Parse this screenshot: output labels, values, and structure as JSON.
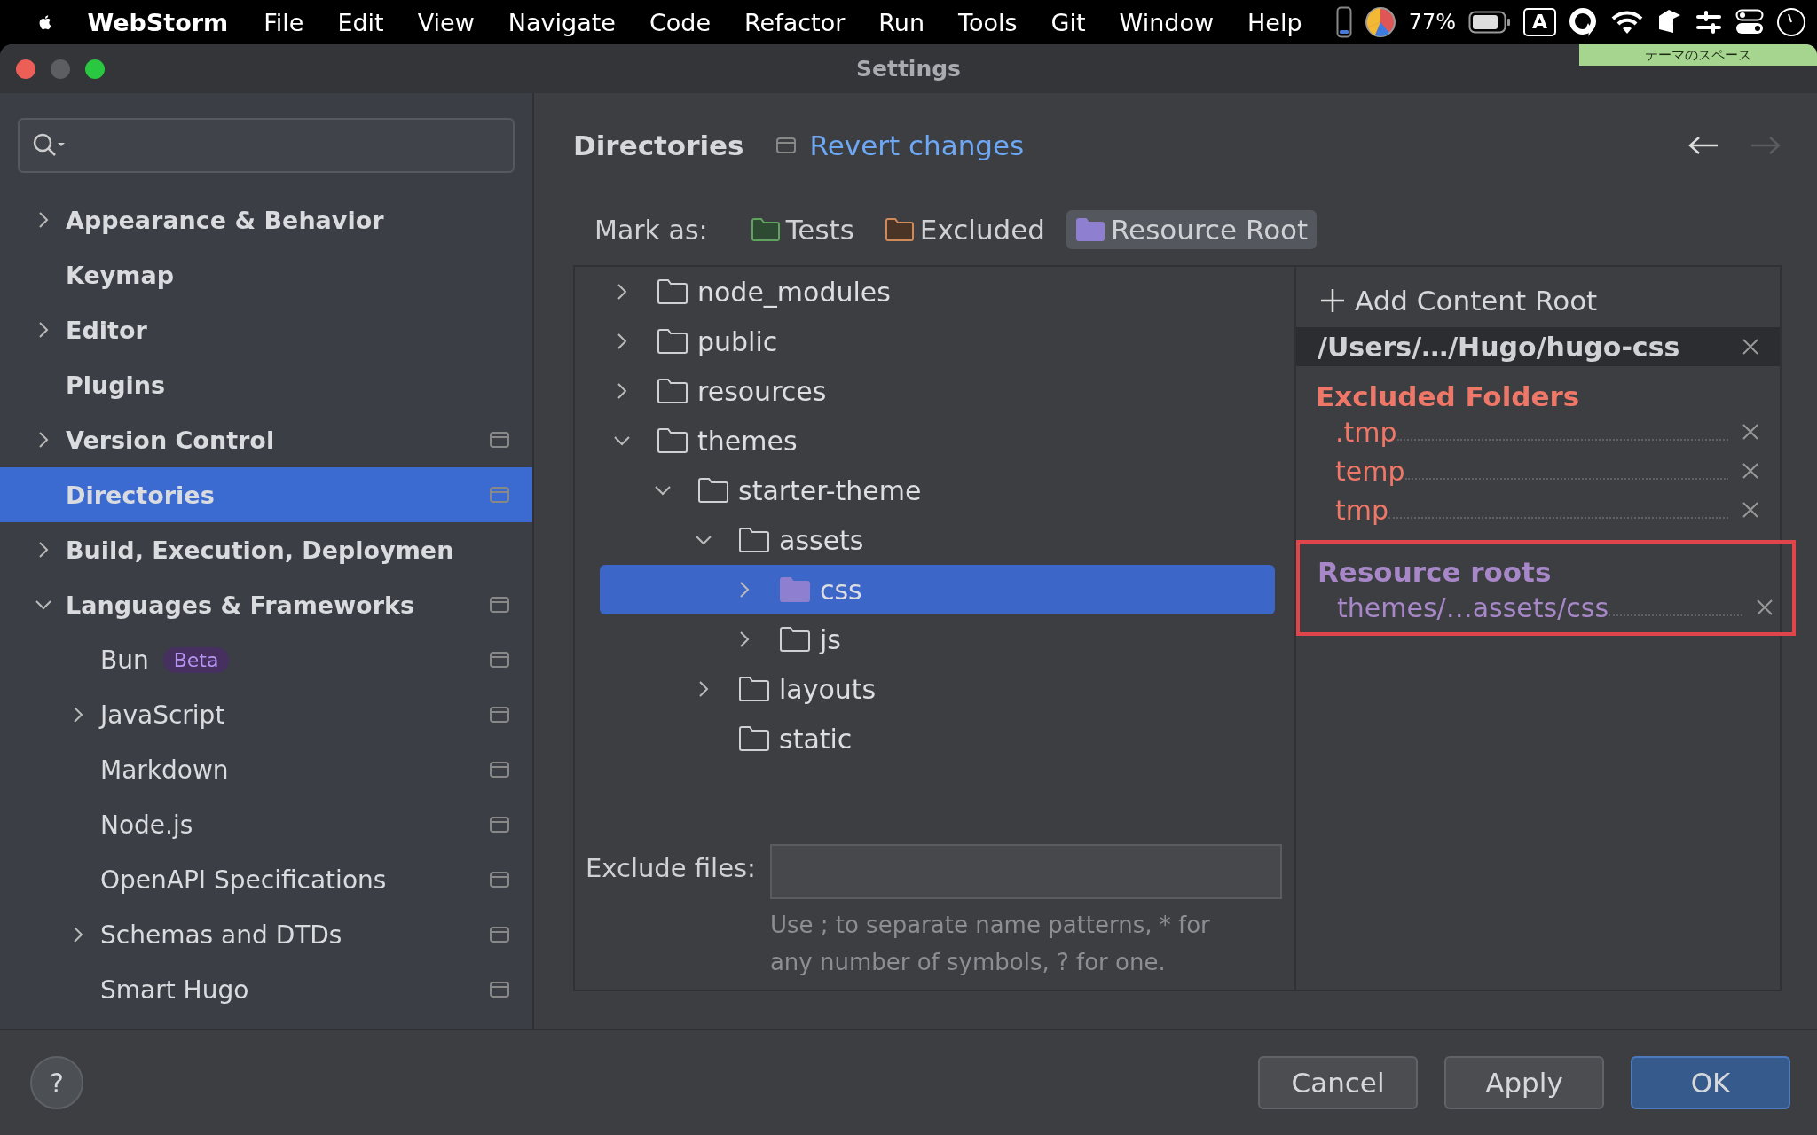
{
  "menu_bar": {
    "app": "WebStorm",
    "items": [
      "File",
      "Edit",
      "View",
      "Navigate",
      "Code",
      "Refactor",
      "Run",
      "Tools",
      "Git",
      "Window",
      "Help"
    ],
    "battery_percent": "77%",
    "input_mode": "A"
  },
  "tooltip": "テーマのスペース",
  "window": {
    "title": "Settings"
  },
  "sidebar": {
    "items": [
      {
        "label": "Appearance & Behavior",
        "expanded": false,
        "selected": false,
        "project_scope": false
      },
      {
        "label": "Keymap",
        "selected": false,
        "project_scope": false
      },
      {
        "label": "Editor",
        "expanded": false,
        "selected": false,
        "project_scope": false
      },
      {
        "label": "Plugins",
        "selected": false,
        "project_scope": false
      },
      {
        "label": "Version Control",
        "expanded": false,
        "selected": false,
        "project_scope": true
      },
      {
        "label": "Directories",
        "selected": true,
        "project_scope": true
      },
      {
        "label": "Build, Execution, Deploymen",
        "expanded": false,
        "selected": false,
        "project_scope": false
      },
      {
        "label": "Languages & Frameworks",
        "expanded": true,
        "selected": false,
        "project_scope": true,
        "children": [
          {
            "label": "Bun",
            "badge": "Beta",
            "selected": false,
            "project_scope": true
          },
          {
            "label": "JavaScript",
            "expanded": false,
            "selected": false,
            "project_scope": true
          },
          {
            "label": "Markdown",
            "selected": false,
            "project_scope": true
          },
          {
            "label": "Node.js",
            "selected": false,
            "project_scope": true
          },
          {
            "label": "OpenAPI Specifications",
            "selected": false,
            "project_scope": true
          },
          {
            "label": "Schemas and DTDs",
            "expanded": false,
            "selected": false,
            "project_scope": true
          },
          {
            "label": "Smart Hugo",
            "selected": false,
            "project_scope": true
          }
        ]
      }
    ]
  },
  "page": {
    "title": "Directories",
    "revert_link": "Revert changes",
    "back_enabled": true,
    "forward_enabled": false
  },
  "mark_as": {
    "label": "Mark as:",
    "options": [
      {
        "label": "Tests",
        "kind": "tests",
        "selected": false
      },
      {
        "label": "Excluded",
        "kind": "excluded",
        "selected": false
      },
      {
        "label": "Resource Root",
        "kind": "resource",
        "selected": true
      }
    ]
  },
  "tree": [
    {
      "name": "node_modules",
      "kind": "plain",
      "expanded": false,
      "selected": false
    },
    {
      "name": "public",
      "kind": "plain",
      "expanded": false,
      "selected": false
    },
    {
      "name": "resources",
      "kind": "plain",
      "expanded": false,
      "selected": false
    },
    {
      "name": "themes",
      "kind": "plain",
      "expanded": true,
      "selected": false,
      "children": [
        {
          "name": "starter-theme",
          "kind": "plain",
          "expanded": true,
          "selected": false,
          "children": [
            {
              "name": "assets",
              "kind": "plain",
              "expanded": true,
              "selected": false,
              "children": [
                {
                  "name": "css",
                  "kind": "resource",
                  "expanded": false,
                  "selected": true
                },
                {
                  "name": "js",
                  "kind": "plain",
                  "expanded": false,
                  "selected": false
                }
              ]
            },
            {
              "name": "layouts",
              "kind": "plain",
              "expanded": false,
              "selected": false
            },
            {
              "name": "static",
              "kind": "plain",
              "selected": false
            }
          ]
        }
      ]
    }
  ],
  "exclude": {
    "label": "Exclude files:",
    "hint": "Use ; to separate name patterns, * for any number of symbols, ? for one."
  },
  "content_root": {
    "add_label": "Add Content Root",
    "path": "/Users/…/Hugo/hugo-css",
    "sections": [
      {
        "kind": "excluded",
        "title": "Excluded Folders",
        "highlighted": false,
        "items": [
          ".tmp",
          "temp",
          "tmp"
        ]
      },
      {
        "kind": "resource",
        "title": "Resource roots",
        "highlighted": true,
        "items": [
          "themes/…assets/css"
        ]
      }
    ]
  },
  "buttons": [
    {
      "label": "Cancel",
      "default": false
    },
    {
      "label": "Apply",
      "default": false
    },
    {
      "label": "OK",
      "default": true
    }
  ],
  "help": "?"
}
